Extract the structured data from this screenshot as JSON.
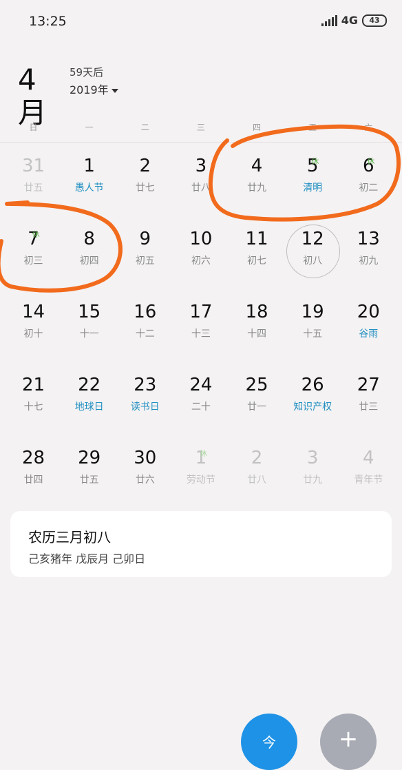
{
  "status_bar": {
    "time": "13:25",
    "network": "4G",
    "battery": "43"
  },
  "header": {
    "month": "4月",
    "days_after": "59天后",
    "year": "2019年"
  },
  "weekdays": [
    "日",
    "一",
    "二",
    "三",
    "四",
    "五",
    "六"
  ],
  "weeks": [
    [
      {
        "day": "31",
        "sub": "廿五",
        "dim": true
      },
      {
        "day": "1",
        "sub": "愚人节",
        "festival": true
      },
      {
        "day": "2",
        "sub": "廿七"
      },
      {
        "day": "3",
        "sub": "廿八"
      },
      {
        "day": "4",
        "sub": "廿九"
      },
      {
        "day": "5",
        "sub": "清明",
        "festival": true,
        "holiday": "休"
      },
      {
        "day": "6",
        "sub": "初二",
        "holiday": "休"
      }
    ],
    [
      {
        "day": "7",
        "sub": "初三",
        "holiday": "休"
      },
      {
        "day": "8",
        "sub": "初四"
      },
      {
        "day": "9",
        "sub": "初五"
      },
      {
        "day": "10",
        "sub": "初六"
      },
      {
        "day": "11",
        "sub": "初七"
      },
      {
        "day": "12",
        "sub": "初八",
        "today": true
      },
      {
        "day": "13",
        "sub": "初九"
      }
    ],
    [
      {
        "day": "14",
        "sub": "初十"
      },
      {
        "day": "15",
        "sub": "十一"
      },
      {
        "day": "16",
        "sub": "十二"
      },
      {
        "day": "17",
        "sub": "十三"
      },
      {
        "day": "18",
        "sub": "十四"
      },
      {
        "day": "19",
        "sub": "十五"
      },
      {
        "day": "20",
        "sub": "谷雨",
        "festival": true
      }
    ],
    [
      {
        "day": "21",
        "sub": "十七"
      },
      {
        "day": "22",
        "sub": "地球日",
        "festival": true
      },
      {
        "day": "23",
        "sub": "读书日",
        "festival": true
      },
      {
        "day": "24",
        "sub": "二十"
      },
      {
        "day": "25",
        "sub": "廿一"
      },
      {
        "day": "26",
        "sub": "知识产权",
        "festival": true
      },
      {
        "day": "27",
        "sub": "廿三"
      }
    ],
    [
      {
        "day": "28",
        "sub": "廿四"
      },
      {
        "day": "29",
        "sub": "廿五"
      },
      {
        "day": "30",
        "sub": "廿六"
      },
      {
        "day": "1",
        "sub": "劳动节",
        "dim": true,
        "holiday": "休"
      },
      {
        "day": "2",
        "sub": "廿八",
        "dim": true
      },
      {
        "day": "3",
        "sub": "廿九",
        "dim": true
      },
      {
        "day": "4",
        "sub": "青年节",
        "dim": true
      }
    ]
  ],
  "lunar_card": {
    "title": "农历三月初八",
    "detail": "己亥猪年 戊辰月 己卯日"
  },
  "fab": {
    "today_label": "今",
    "add_label": "+"
  },
  "colors": {
    "festival": "#1f8fc0",
    "holiday": "#5ab04a",
    "fab_today": "#1e92e6",
    "fab_add": "#a8abb4",
    "annotation": "#f26b1d"
  }
}
